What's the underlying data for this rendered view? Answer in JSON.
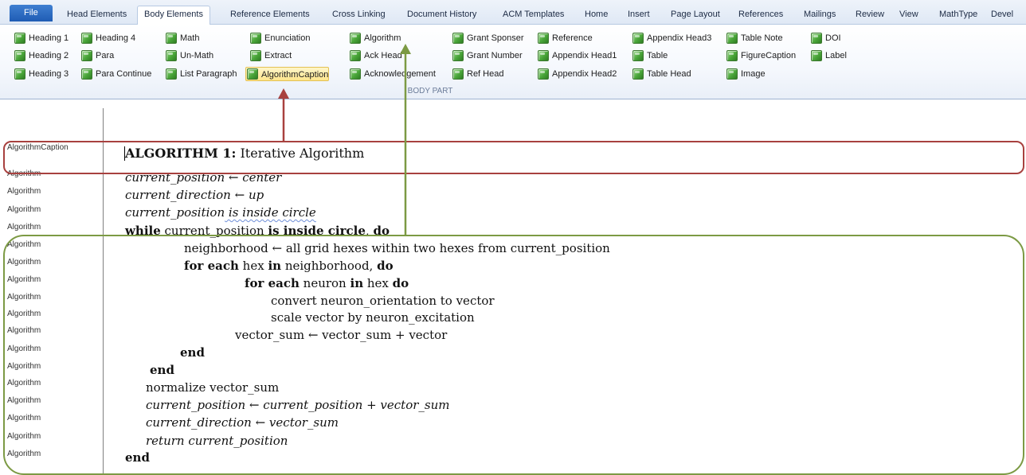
{
  "tabs": [
    {
      "label": "File"
    },
    {
      "label": "Head Elements"
    },
    {
      "label": "Body Elements"
    },
    {
      "label": "Reference Elements"
    },
    {
      "label": "Cross Linking"
    },
    {
      "label": "Document History"
    },
    {
      "label": "ACM Templates"
    },
    {
      "label": "Home"
    },
    {
      "label": "Insert"
    },
    {
      "label": "Page Layout"
    },
    {
      "label": "References"
    },
    {
      "label": "Mailings"
    },
    {
      "label": "Review"
    },
    {
      "label": "View"
    },
    {
      "label": "MathType"
    },
    {
      "label": "Devel"
    }
  ],
  "ribbon": {
    "group_label": "BODY PART",
    "items": [
      {
        "label": "Heading 1"
      },
      {
        "label": "Heading 2"
      },
      {
        "label": "Heading 3"
      },
      {
        "label": "Heading 4"
      },
      {
        "label": "Para"
      },
      {
        "label": "Para Continue"
      },
      {
        "label": "Math"
      },
      {
        "label": "Un-Math"
      },
      {
        "label": "List Paragraph"
      },
      {
        "label": "Enunciation"
      },
      {
        "label": "Extract"
      },
      {
        "label": "AlgorithmCaption"
      },
      {
        "label": "Algorithm"
      },
      {
        "label": "Ack Head"
      },
      {
        "label": "Acknowledgement"
      },
      {
        "label": "Grant Sponser"
      },
      {
        "label": "Grant Number"
      },
      {
        "label": "Ref Head"
      },
      {
        "label": "Reference"
      },
      {
        "label": "Appendix Head1"
      },
      {
        "label": "Appendix Head2"
      },
      {
        "label": "Appendix Head3"
      },
      {
        "label": "Table"
      },
      {
        "label": "Table Head"
      },
      {
        "label": "Table Note"
      },
      {
        "label": "FigureCaption"
      },
      {
        "label": "Image"
      },
      {
        "label": "DOI"
      },
      {
        "label": "Label"
      }
    ]
  },
  "style_labels": [
    "AlgorithmCaption",
    "Algorithm",
    "Algorithm",
    "Algorithm",
    "Algorithm",
    "Algorithm",
    "Algorithm",
    "Algorithm",
    "Algorithm",
    "Algorithm",
    "Algorithm",
    "Algorithm",
    "Algorithm",
    "Algorithm",
    "Algorithm",
    "Algorithm",
    "Algorithm",
    "Algorithm",
    "Algorithm"
  ],
  "doc": {
    "caption_keyword": "ALGORITHM 1:",
    "caption_text": " Iterative Algorithm",
    "l1a": "current_position",
    "l1b": "←",
    "l1c": "center",
    "l2a": "current_direction",
    "l2b": "←",
    "l2c": "up",
    "l3a": "current_position",
    "l3b": " is inside circle",
    "l4a": "while",
    "l4b": " current_position ",
    "l4c": "is inside circle",
    "l4d": ", ",
    "l4e": "do",
    "l5": "neighborhood ← all grid hexes within two hexes from current_position",
    "l6a": "for each",
    "l6b": " hex ",
    "l6c": "in",
    "l6d": " neighborhood, ",
    "l6e": "do",
    "l7a": "for each",
    "l7b": " neuron ",
    "l7c": "in",
    "l7d": " hex ",
    "l7e": "do",
    "l8": "convert neuron_orientation to vector",
    "l9": "scale vector by neuron_excitation",
    "l10": "vector_sum ← vector_sum + vector",
    "l11": "end",
    "l12": "end",
    "l13": "normalize vector_sum",
    "l14": "current_position ← current_position + vector_sum",
    "l15": "current_direction ← vector_sum",
    "l16": "return current_position",
    "l17": "end"
  },
  "colors": {
    "caption_box": "#a8413f",
    "algorithm_box": "#7c9a44",
    "selected_item": "#ffe68c",
    "file_tab": "#2b6cc4"
  }
}
